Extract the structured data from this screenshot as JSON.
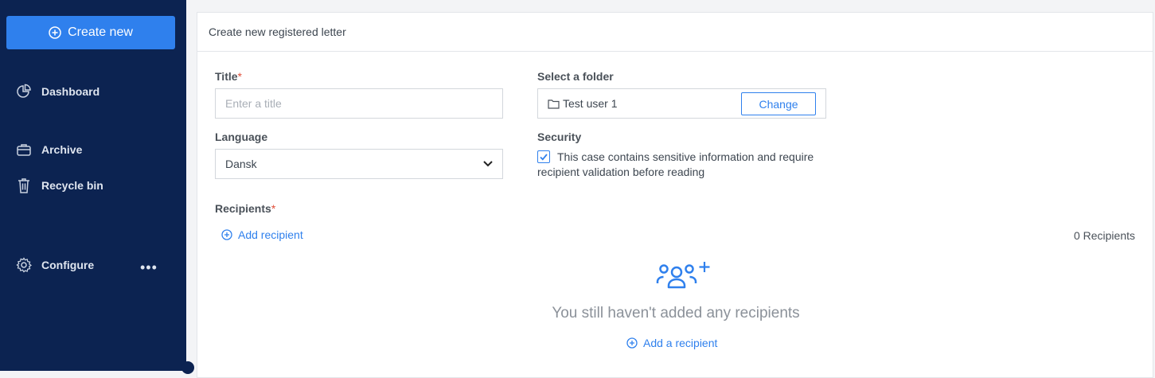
{
  "sidebar": {
    "create_label": "Create new",
    "items": [
      {
        "label": "Dashboard",
        "icon": "pie-chart-icon"
      },
      {
        "label": "Archive",
        "icon": "briefcase-icon"
      },
      {
        "label": "Recycle bin",
        "icon": "trash-icon"
      },
      {
        "label": "Configure",
        "icon": "gear-icon"
      }
    ],
    "more_label": "•••"
  },
  "form": {
    "header": "Create new registered letter",
    "title_label": "Title",
    "required_mark": "*",
    "title_placeholder": "Enter a title",
    "title_value": "",
    "folder_label": "Select a folder",
    "folder_value": "Test user 1",
    "change_label": "Change",
    "language_label": "Language",
    "language_value": "Dansk",
    "security_label": "Security",
    "security_checked": true,
    "security_text": "This case contains sensitive information and require recipient validation before reading",
    "recipients_label": "Recipients",
    "add_recipient_label": "Add recipient",
    "recipients_count": "0 Recipients",
    "empty_text": "You still haven't added any recipients",
    "add_a_recipient_label": "Add a recipient"
  },
  "colors": {
    "sidebar_bg": "#0c2351",
    "accent": "#2f80ed",
    "required": "#e04e39"
  }
}
